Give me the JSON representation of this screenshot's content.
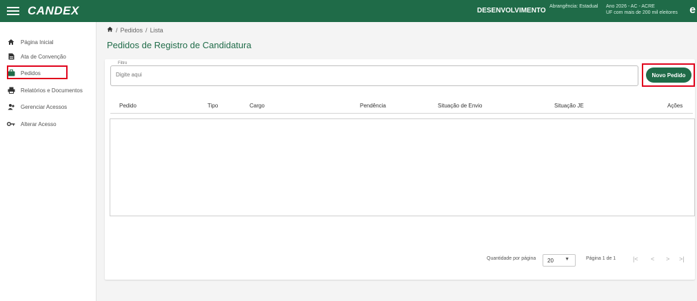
{
  "topbar": {
    "logo": "CANDEX",
    "environment": "DESENVOLVIMENTO",
    "scope": "Abrangência: Estadual",
    "year_state": "Ano 2026 - AC - ACRE",
    "uf_info": "UF com mais de 200 mil eleitores",
    "user_initial": "e"
  },
  "sidebar": {
    "items": [
      {
        "label": "Página Inicial",
        "icon": "home-icon"
      },
      {
        "label": "Ata de Convenção",
        "icon": "document-icon"
      },
      {
        "label": "Pedidos",
        "icon": "briefcase-icon"
      },
      {
        "label": "Relatórios e Documentos",
        "icon": "printer-icon"
      },
      {
        "label": "Gerenciar Acessos",
        "icon": "users-icon"
      },
      {
        "label": "Alterar Acesso",
        "icon": "key-icon"
      }
    ]
  },
  "breadcrumb": {
    "sep": "/",
    "items": [
      "Pedidos",
      "Lista"
    ]
  },
  "page": {
    "title": "Pedidos de Registro de Candidatura"
  },
  "filter": {
    "label": "Filtro",
    "placeholder": "Digite aqui"
  },
  "new_button": {
    "label": "Novo Pedido"
  },
  "table": {
    "columns": [
      "Pedido",
      "Tipo",
      "Cargo",
      "Pendência",
      "Situação de Envio",
      "Situação JE",
      "Ações"
    ]
  },
  "pagination": {
    "per_page_label": "Quantidade por página",
    "per_page_value": "20",
    "page_info": "Página 1 de 1"
  },
  "colors": {
    "primary": "#1f6b48",
    "highlight": "#e0001a"
  }
}
